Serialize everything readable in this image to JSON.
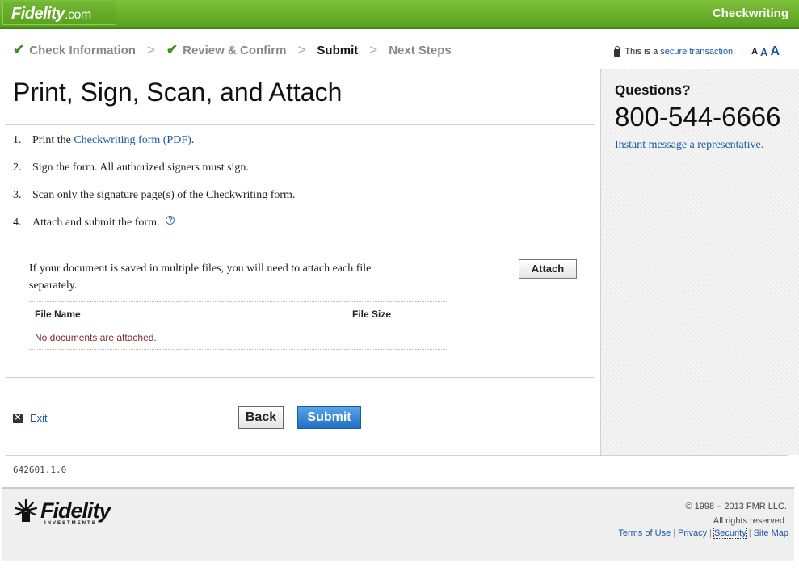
{
  "header": {
    "logo_main": "Fidelity",
    "logo_suffix": ".com",
    "title": "Checkwriting"
  },
  "steps": [
    {
      "label": "Check Information",
      "state": "complete"
    },
    {
      "label": "Review & Confirm",
      "state": "complete"
    },
    {
      "label": "Submit",
      "state": "current"
    },
    {
      "label": "Next Steps",
      "state": "upcoming"
    }
  ],
  "secure": {
    "prefix": "This is a",
    "link": "secure transaction.",
    "text_sizes": [
      "A",
      "A",
      "A"
    ]
  },
  "main": {
    "title": "Print, Sign, Scan, and Attach",
    "instructions": [
      {
        "num": "1.",
        "before": "Print the ",
        "link": "Checkwriting form (PDF)",
        "after": "."
      },
      {
        "num": "2.",
        "text": "Sign the form. All authorized signers must sign."
      },
      {
        "num": "3.",
        "text": "Scan only the signature page(s) of the Checkwriting form."
      },
      {
        "num": "4.",
        "text": "Attach and submit the form."
      }
    ],
    "multi_file_note": "If your document is saved in multiple files, you will need to attach each file separately.",
    "attach_label": "Attach",
    "table": {
      "columns": [
        "File Name",
        "File Size"
      ],
      "empty_message": "No documents are attached."
    },
    "exit_label": "Exit",
    "back_label": "Back",
    "submit_label": "Submit"
  },
  "sidebar": {
    "title": "Questions?",
    "phone": "800-544-6666",
    "im_link": "Instant message a representative."
  },
  "page_id": "642601.1.0",
  "footer": {
    "logo_word": "Fidelity",
    "logo_sub": "INVESTMENTS",
    "copyright_line1": "© 1998 – 2013 FMR LLC.",
    "copyright_line2": "All rights reserved.",
    "links": [
      "Terms of Use",
      "Privacy",
      "Security",
      "Site Map"
    ]
  },
  "colors": {
    "brand_green": "#5aa21f",
    "link_blue": "#1a56a8",
    "submit_blue": "#1e6fc5"
  }
}
